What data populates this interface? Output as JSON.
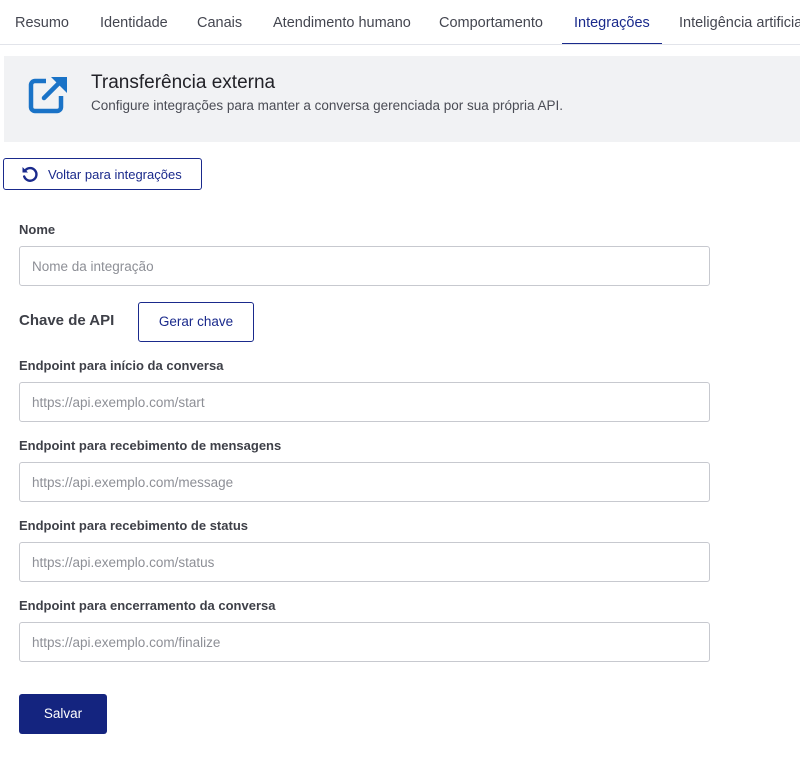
{
  "tabs": [
    {
      "label": "Resumo",
      "active": false
    },
    {
      "label": "Identidade",
      "active": false
    },
    {
      "label": "Canais",
      "active": false
    },
    {
      "label": "Atendimento humano",
      "active": false
    },
    {
      "label": "Comportamento",
      "active": false
    },
    {
      "label": "Integrações",
      "active": true
    },
    {
      "label": "Inteligência artificial",
      "active": false
    }
  ],
  "header": {
    "icon": "external-link-icon",
    "title": "Transferência externa",
    "subtitle": "Configure integrações para manter a conversa gerenciada por sua própria API."
  },
  "back_button": {
    "icon": "undo-icon",
    "label": "Voltar para integrações"
  },
  "form": {
    "name": {
      "label": "Nome",
      "placeholder": "Nome da integração",
      "value": ""
    },
    "api_key": {
      "label": "Chave de API",
      "button": "Gerar chave"
    },
    "start_endpoint": {
      "label": "Endpoint para início da conversa",
      "placeholder": "https://api.exemplo.com/start",
      "value": ""
    },
    "message_endpoint": {
      "label": "Endpoint para recebimento de mensagens",
      "placeholder": "https://api.exemplo.com/message",
      "value": ""
    },
    "status_endpoint": {
      "label": "Endpoint para recebimento de status",
      "placeholder": "https://api.exemplo.com/status",
      "value": ""
    },
    "finalize_endpoint": {
      "label": "Endpoint para encerramento da conversa",
      "placeholder": "https://api.exemplo.com/finalize",
      "value": ""
    },
    "save_label": "Salvar"
  },
  "colors": {
    "primary": "#1a2a8c",
    "icon_blue": "#1a73c7",
    "banner_bg": "#f1f2f4"
  }
}
